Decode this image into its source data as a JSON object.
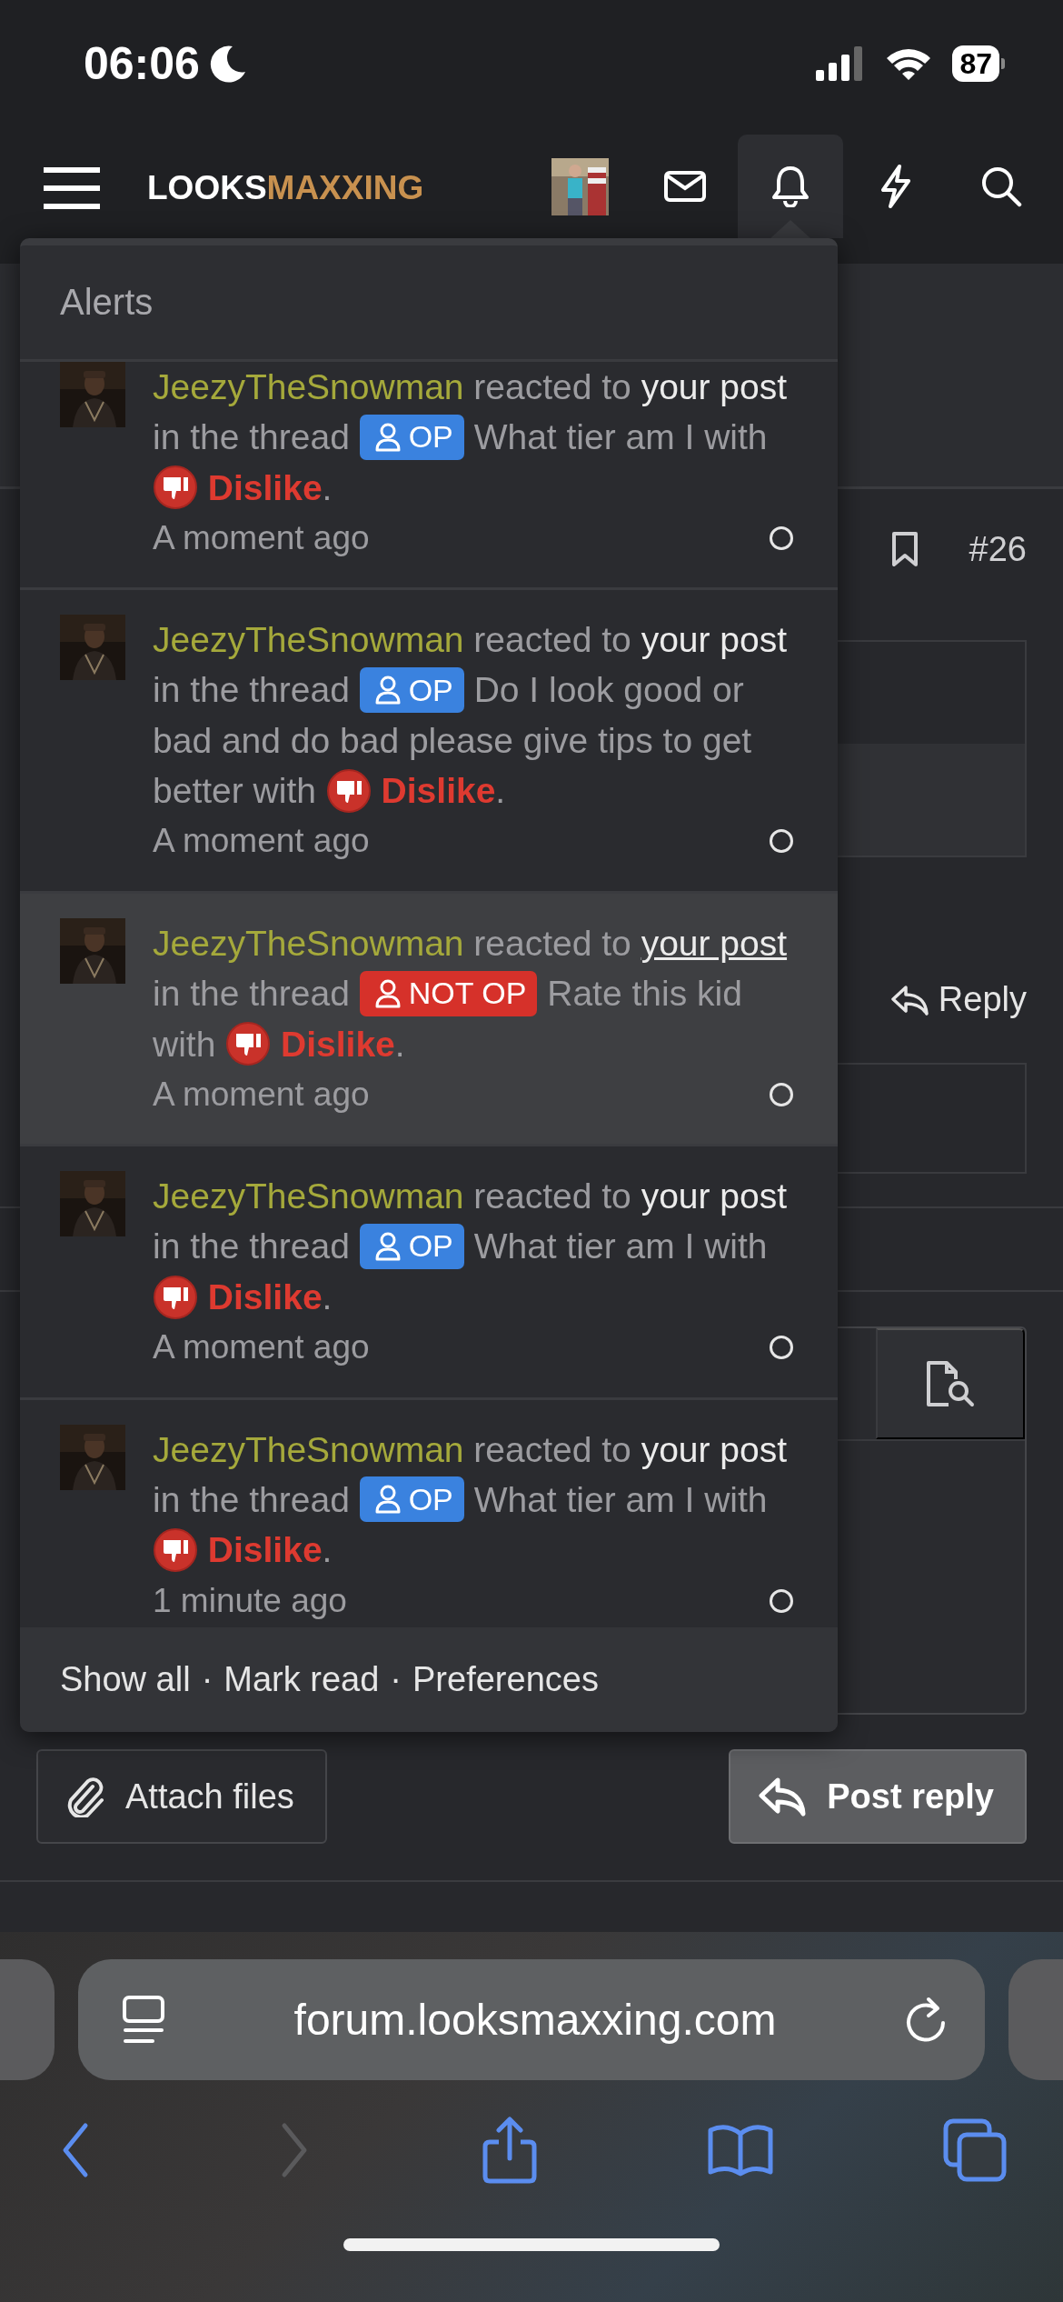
{
  "status_bar": {
    "time": "06:06",
    "battery": "87"
  },
  "header": {
    "logo": [
      {
        "text": "LOOKS",
        "kind": "plain"
      },
      {
        "text": "MAXXING",
        "kind": "accent"
      }
    ],
    "nav": [
      {
        "kind": "avatar",
        "selected": false
      },
      {
        "kind": "mail",
        "selected": false
      },
      {
        "kind": "bell",
        "selected": true
      },
      {
        "kind": "bolt",
        "selected": false
      },
      {
        "kind": "search",
        "selected": false
      }
    ]
  },
  "post": {
    "number": "#26",
    "reply": "Reply"
  },
  "editor": {
    "attach": "Attach files",
    "submit": "Post reply"
  },
  "alerts": {
    "title": "Alerts",
    "items": [
      {
        "user": "JeezyTheSnowman",
        "action": "reacted to",
        "link": "your post",
        "context": "in the thread",
        "prefix": {
          "label": "OP",
          "kind": "op"
        },
        "thread": "What tier am I",
        "connector": "with",
        "reaction": "Dislike",
        "ending": ".",
        "time": "A moment ago",
        "selected": false,
        "read": false
      },
      {
        "user": "JeezyTheSnowman",
        "action": "reacted to",
        "link": "your post",
        "context": "in the thread",
        "prefix": {
          "label": "OP",
          "kind": "op"
        },
        "thread": "Do I look good or bad and do bad please give tips to get better",
        "connector": "with",
        "reaction": "Dislike",
        "ending": ".",
        "time": "A moment ago",
        "selected": false,
        "read": false
      },
      {
        "user": "JeezyTheSnowman",
        "action": "reacted to",
        "link": "your post",
        "context": "in the thread",
        "prefix": {
          "label": "NOT OP",
          "kind": "not_op"
        },
        "thread": "Rate this kid",
        "connector": "with",
        "reaction": "Dislike",
        "ending": ".",
        "time": "A moment ago",
        "selected": true,
        "read": false
      },
      {
        "user": "JeezyTheSnowman",
        "action": "reacted to",
        "link": "your post",
        "context": "in the thread",
        "prefix": {
          "label": "OP",
          "kind": "op"
        },
        "thread": "What tier am I",
        "connector": "with",
        "reaction": "Dislike",
        "ending": ".",
        "time": "A moment ago",
        "selected": false,
        "read": false
      },
      {
        "user": "JeezyTheSnowman",
        "action": "reacted to",
        "link": "your post",
        "context": "in the thread",
        "prefix": {
          "label": "OP",
          "kind": "op"
        },
        "thread": "What tier am I",
        "connector": "with",
        "reaction": "Dislike",
        "ending": ".",
        "time": "1 minute ago",
        "selected": false,
        "read": false
      }
    ],
    "footer": [
      {
        "label": "Show all"
      },
      {
        "label": "Mark read"
      },
      {
        "label": "Preferences"
      }
    ],
    "footer_separator": "·"
  },
  "browser": {
    "url": "forum.looksmaxxing.com"
  }
}
